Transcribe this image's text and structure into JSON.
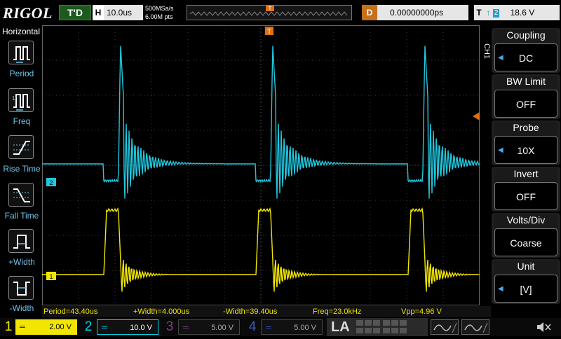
{
  "top": {
    "brand": "RIGOL",
    "trigger_status": "T'D",
    "horizontal_key": "H",
    "horizontal_scale": "10.0us",
    "sample_rate": "500MSa/s",
    "memory_depth": "6.00M pts",
    "delay_key": "D",
    "delay_value": "0.00000000ps",
    "trigger_key": "T",
    "trigger_edge": "↑",
    "trigger_channel": "2",
    "trigger_level": "18.6 V"
  },
  "left_menu": {
    "title": "Horizontal",
    "items": [
      {
        "label": "Period"
      },
      {
        "label": "Freq"
      },
      {
        "label": "Rise Time"
      },
      {
        "label": "Fall Time"
      },
      {
        "label": "+Width"
      },
      {
        "label": "-Width"
      }
    ]
  },
  "right_menu": {
    "channel_tag": "CH1",
    "items": [
      {
        "title": "Coupling",
        "value": "DC"
      },
      {
        "title": "BW Limit",
        "value": "OFF"
      },
      {
        "title": "Probe",
        "value": "10X"
      },
      {
        "title": "Invert",
        "value": "OFF"
      },
      {
        "title": "Volts/Div",
        "value": "Coarse"
      },
      {
        "title": "Unit",
        "value": "[V]"
      }
    ]
  },
  "markers": {
    "trigger_pos": "T",
    "ch2_marker": "2",
    "ch1_marker": "1"
  },
  "measurements": [
    "Period=43.40us",
    "+Width=4.000us",
    "-Width=39.40us",
    "Freq=23.0kHz",
    "Vpp=4.96 V"
  ],
  "channels": [
    {
      "num": "1",
      "scale": "2.00 V",
      "color": "#f2e600",
      "active": true
    },
    {
      "num": "2",
      "scale": "10.0 V",
      "color": "#00d2e6",
      "active": true
    },
    {
      "num": "3",
      "scale": "5.00 V",
      "color": "#c040c0",
      "active": false
    },
    {
      "num": "4",
      "scale": "5.00 V",
      "color": "#3060e0",
      "active": false
    }
  ],
  "la_label": "LA",
  "colors": {
    "ch1": "#f2e600",
    "ch2": "#20c8e0",
    "accent_orange": "#e07010",
    "menu_blue": "#49a8e8"
  }
}
